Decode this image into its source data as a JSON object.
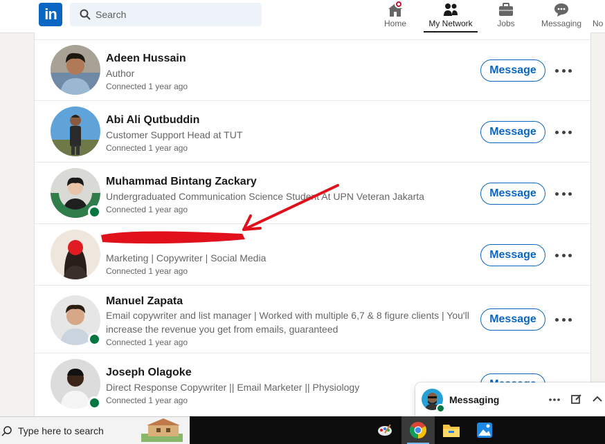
{
  "nav": {
    "search_placeholder": "Search",
    "items": [
      {
        "label": "Home",
        "icon": "home-icon"
      },
      {
        "label": "My Network",
        "icon": "network-icon"
      },
      {
        "label": "Jobs",
        "icon": "briefcase-icon"
      },
      {
        "label": "Messaging",
        "icon": "messaging-icon"
      },
      {
        "label": "No",
        "icon": "bell-icon"
      }
    ],
    "active": "My Network",
    "brand_color": "#0a66c2",
    "notification_color": "#cb112d"
  },
  "connections": [
    {
      "name": "Adeen Hussain",
      "headline": "Author",
      "connected": "Connected 1 year ago",
      "button": "Message",
      "online": false
    },
    {
      "name": "Abi Ali Qutbuddin",
      "headline": "Customer Support Head at TUT",
      "connected": "Connected 1 year ago",
      "button": "Message",
      "online": false
    },
    {
      "name": "Muhammad Bintang Zackary",
      "headline": "Undergraduated Communication Science Student At UPN Veteran Jakarta",
      "connected": "Connected 1 year ago",
      "button": "Message",
      "online": true,
      "badge_text": "#OPENTOWORK"
    },
    {
      "name": "",
      "headline": "Marketing | Copywriter | Social Media",
      "connected": "Connected 1 year ago",
      "button": "Message",
      "online": false,
      "redacted": true
    },
    {
      "name": "Manuel Zapata",
      "headline": "Email copywriter and list manager | Worked with multiple 6,7 & 8 figure clients | You'll increase the revenue you get from emails, guaranteed",
      "connected": "Connected 1 year ago",
      "button": "Message",
      "online": true
    },
    {
      "name": "Joseph Olagoke",
      "headline": "Direct Response Copywriter || Email Marketer || Physiology",
      "connected": "Connected 1 year ago",
      "button": "Message",
      "online": true
    }
  ],
  "messaging": {
    "title": "Messaging",
    "online_color": "#057642"
  },
  "taskbar": {
    "search_placeholder": "Type here to search",
    "apps": [
      "paint-icon",
      "chrome-icon",
      "file-explorer-icon",
      "photos-icon"
    ]
  }
}
